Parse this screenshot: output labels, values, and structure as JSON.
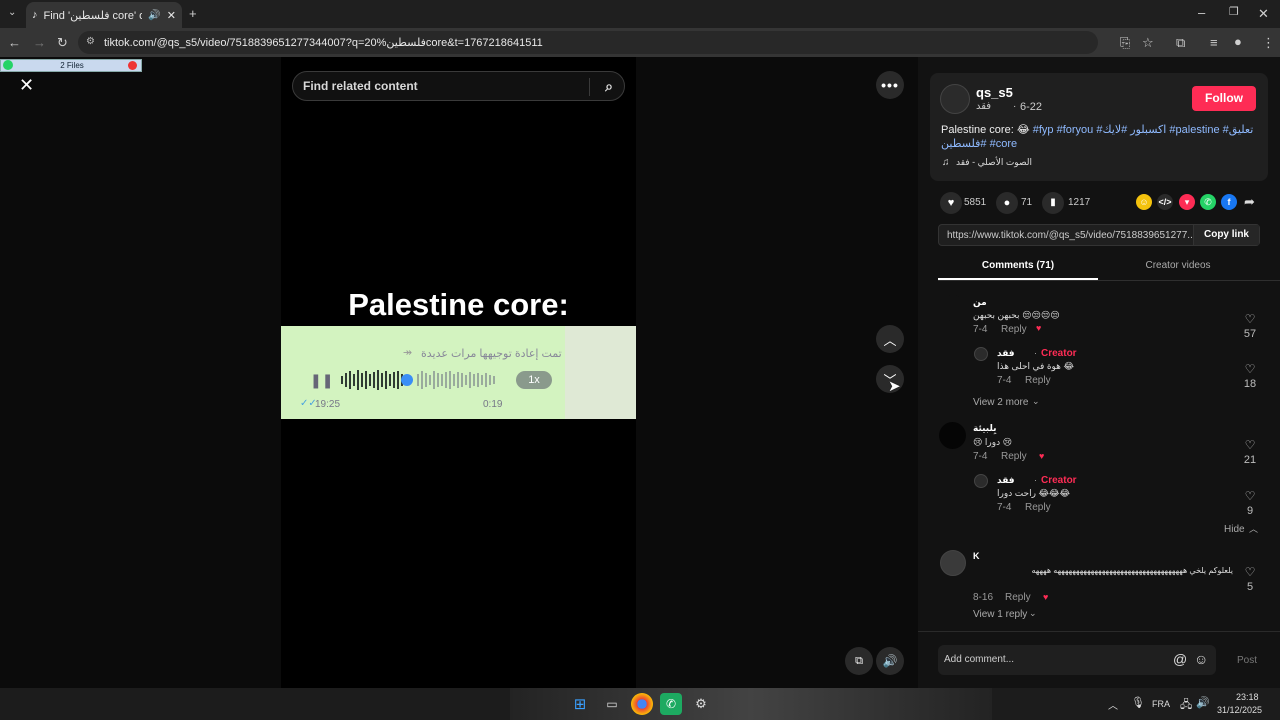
{
  "browser": {
    "tab_title": "Find 'فلسطين core' on TikT",
    "url": "tiktok.com/@qs_s5/video/7518839651277344007?q=20%فلسطينcore&t=1767218641511"
  },
  "whatsapp_strip": {
    "label": "2 Files"
  },
  "search": {
    "placeholder": "Find related content"
  },
  "video": {
    "title": "Palestine core:",
    "voice_note": {
      "forwarded": "تمت إعادة توجيهها مرات عديدة",
      "speed": "1x",
      "time_sent": "19:25",
      "duration": "0:19"
    }
  },
  "author": {
    "username": "qs_s5",
    "nickname": "فقد",
    "date": "6-22",
    "follow_label": "Follow"
  },
  "caption": {
    "text": "Palestine core: 😂",
    "hashtags": [
      "#fyp",
      "#foryou",
      "#اكسبلور",
      "#لايك",
      "#palestine",
      "#تعليق",
      "#فلسطين",
      "#core"
    ]
  },
  "music": {
    "label": "الصوت الأصلي - فقد"
  },
  "stats": {
    "likes": "5851",
    "comments": "71",
    "saves": "1217"
  },
  "link": {
    "url": "https://www.tiktok.com/@qs_s5/video/7518839651277...",
    "copy_label": "Copy link"
  },
  "tabs": {
    "comments": "Comments (71)",
    "creator_videos": "Creator videos"
  },
  "comments": [
    {
      "user": "من",
      "text": "بحبهن بحبهن 😒😒😒😒",
      "date": "7-4",
      "reply": "Reply",
      "likes": "57"
    },
    {
      "user": "فقد",
      "creator_label": "Creator",
      "text": "هوة في احلى هذا 😂",
      "date": "7-4",
      "reply": "Reply",
      "likes": "18"
    },
    {
      "view_more": "View 2 more"
    },
    {
      "user": "بِلبيئة",
      "text": "😢 دورا 😢",
      "date": "7-4",
      "reply": "Reply",
      "likes": "21"
    },
    {
      "user": "فقد",
      "creator_label": "Creator",
      "text": "راحت دورا 😂😂😂",
      "date": "7-4",
      "reply": "Reply",
      "likes": "9"
    },
    {
      "hide": "Hide"
    },
    {
      "user": "K",
      "text": "يلعلوكم يلخي هههههههههههههههههههههههههههههههههههه ههههه",
      "date": "8-16",
      "reply": "Reply",
      "likes": "5"
    },
    {
      "view_reply": "View 1 reply"
    }
  ],
  "add_comment": {
    "placeholder": "Add comment...",
    "post_label": "Post"
  },
  "taskbar": {
    "lang": "FRA",
    "time": "23:18",
    "date": "31/12/2025"
  },
  "colors": {
    "accent": "#fe2c55",
    "hashtag": "#8fbaff",
    "voice_bg": "#d3f3c0"
  }
}
